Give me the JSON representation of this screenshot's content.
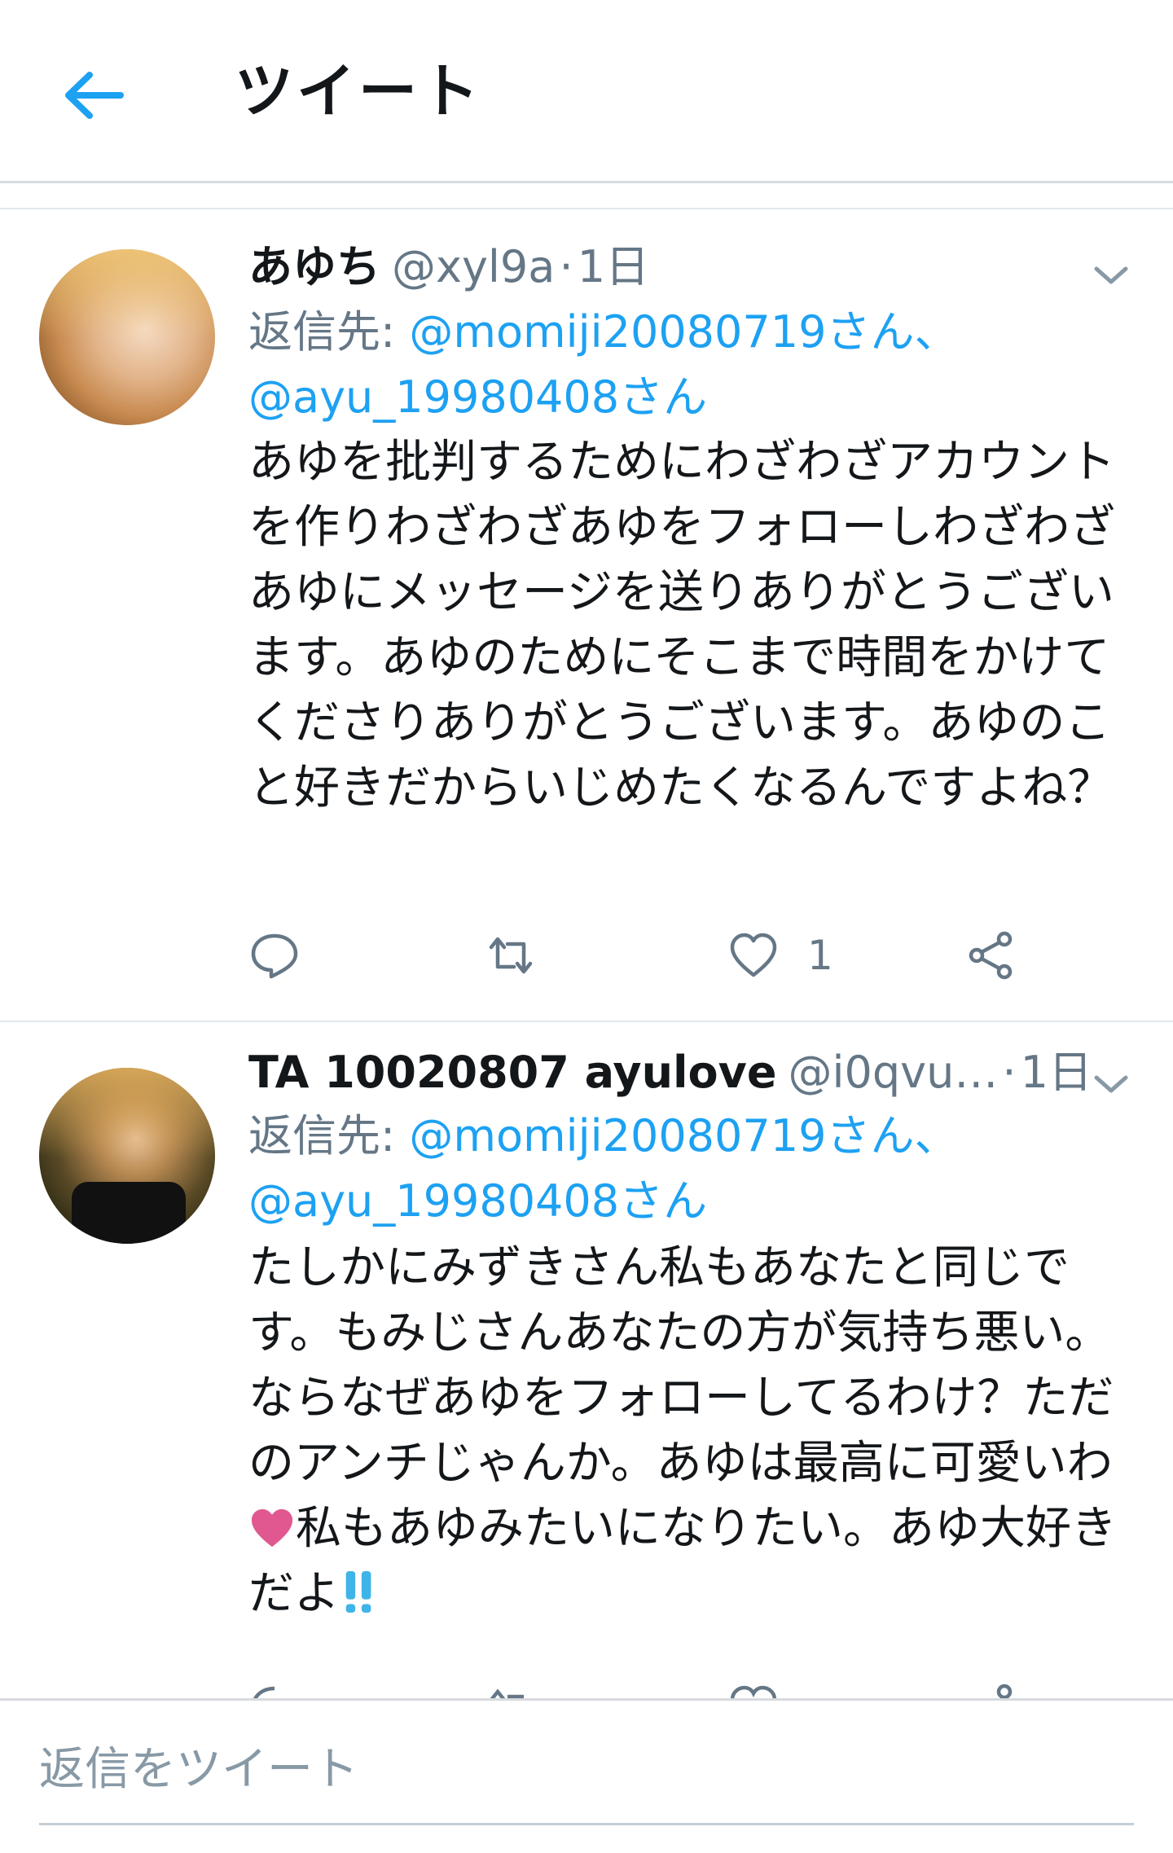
{
  "header": {
    "title": "ツイート",
    "back_icon": "arrow-left-icon",
    "accent": "#1da1f2"
  },
  "tweets": [
    {
      "name": "あゆち",
      "handle": "@xyl9a",
      "separator": "·",
      "time": "1日",
      "reply_prefix": "返信先: ",
      "mention1": "@momiji20080719さん、",
      "mention2": "@ayu_19980408さん",
      "text": "あゆを批判するためにわざわざアカウントを作りわざわざあゆをフォローしわざわざあゆにメッセージを送りありがとうございます。あゆのためにそこまで時間をかけてくださりありがとうございます。あゆのこと好きだからいじめたくなるんですよね？",
      "like_count": "1"
    },
    {
      "name": "TA 10020807 ayulove",
      "handle": "@i0qvu…",
      "separator": "·",
      "time": "1日",
      "reply_prefix": "返信先: ",
      "mention1": "@momiji20080719さん、",
      "mention2": "@ayu_19980408さん",
      "text_part1": "たしかにみずきさん私もあなたと同じです。もみじさんあなたの方が気持ち悪い。ならなぜあゆをフォローしてるわけ？ただのアンチじゃんか。あゆは最高に可愛いわ",
      "text_part2": "私もあゆみたいになりたい。あゆ大好きだよ",
      "emoji1": "heart-emoji",
      "emoji2": "double-exclamation-emoji"
    }
  ],
  "reply_bar": {
    "placeholder": "返信をツイート"
  },
  "colors": {
    "text": "#14171a",
    "secondary": "#657786",
    "link": "#1da1f2",
    "divider": "#e1e8ed",
    "heart": "#e0588f"
  }
}
